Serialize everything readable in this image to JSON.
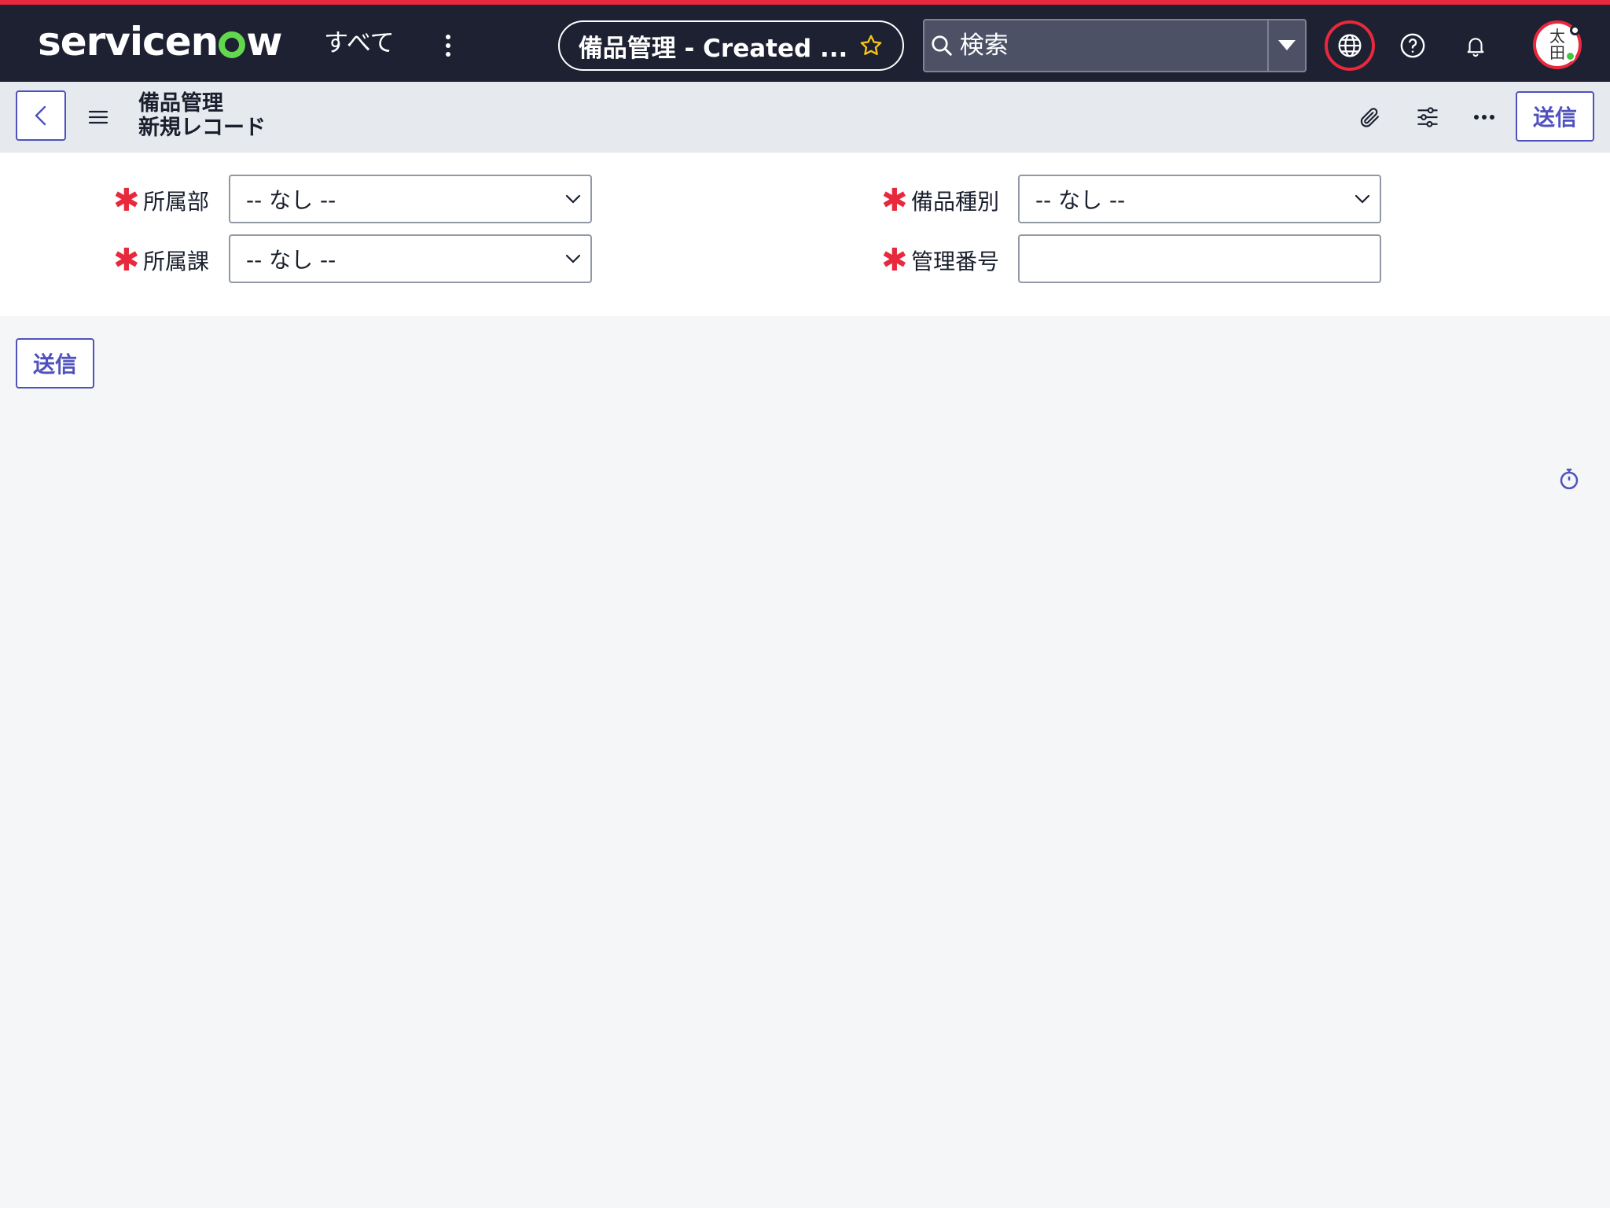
{
  "header": {
    "logo_text_pre": "servicen",
    "logo_text_post": "w",
    "all_menu_label": "すべて",
    "context_title": "備品管理 - Created ...",
    "favorite_icon": "star-outline-icon",
    "search_placeholder": "検索",
    "avatar_initials_line1": "太",
    "avatar_initials_line2": "田"
  },
  "form_header": {
    "title_line1": "備品管理",
    "title_line2": "新規レコード",
    "submit_label": "送信"
  },
  "form": {
    "fields": [
      {
        "label": "所属部",
        "required": true,
        "type": "select",
        "value": "-- なし --"
      },
      {
        "label": "所属課",
        "required": true,
        "type": "select",
        "value": "-- なし --"
      },
      {
        "label": "備品種別",
        "required": true,
        "type": "select",
        "value": "-- なし --"
      },
      {
        "label": "管理番号",
        "required": true,
        "type": "text",
        "value": ""
      }
    ],
    "required_marker": "✱",
    "submit_label": "送信"
  },
  "colors": {
    "header_bg": "#1d2132",
    "accent_red": "#e8283d",
    "logo_green": "#62d84e",
    "button_blue": "#4f52bd",
    "formbar_bg": "#e6e9ee",
    "page_bg": "#f5f6f8"
  }
}
